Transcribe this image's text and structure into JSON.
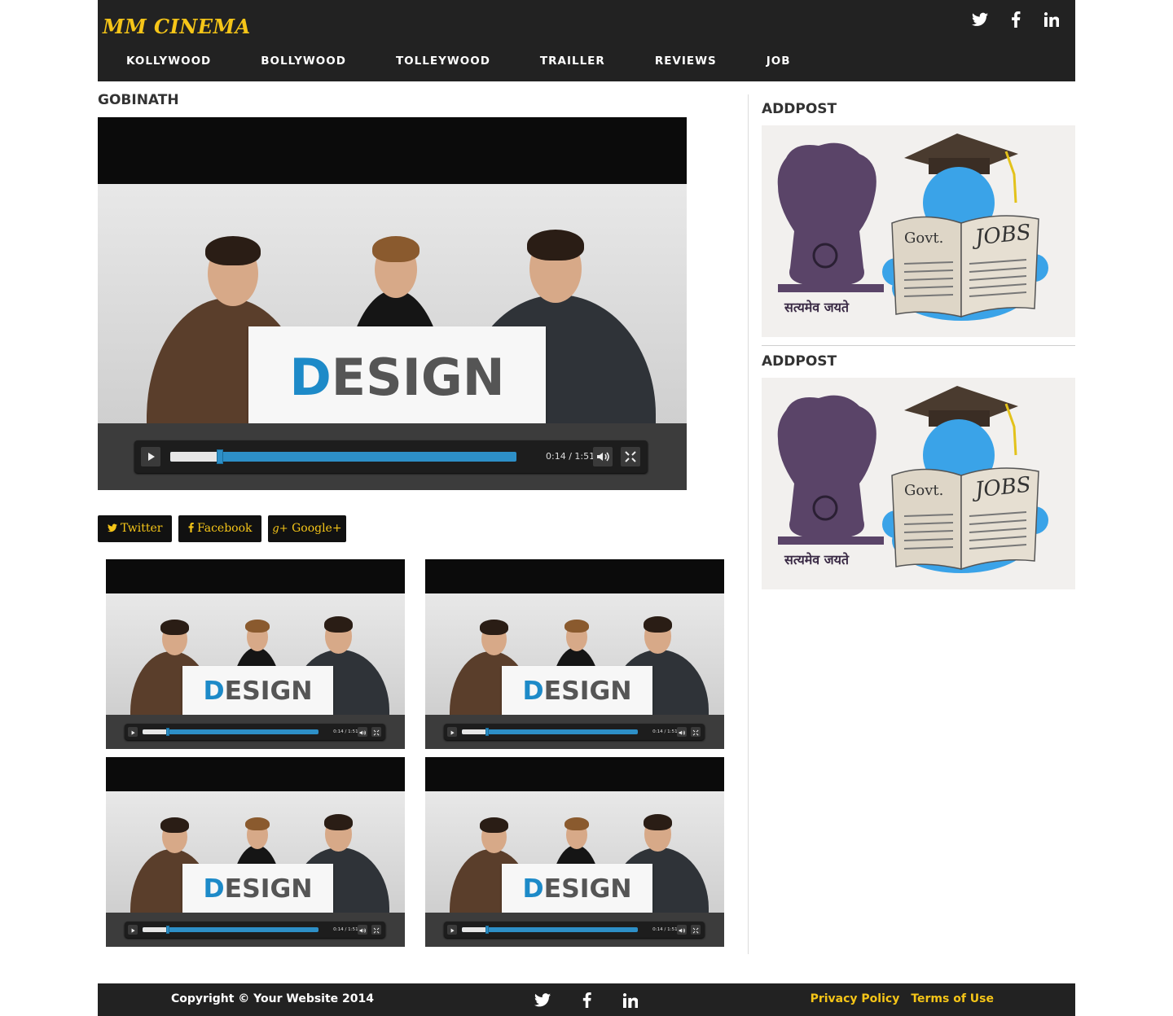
{
  "site": {
    "logo": "MM CINEMA",
    "nav": [
      "KOLLYWOOD",
      "BOLLYWOOD",
      "TOLLEYWOOD",
      "TRAILLER",
      "REVIEWS",
      "JOB"
    ],
    "social_icons": [
      "twitter-icon",
      "facebook-icon",
      "linkedin-icon"
    ]
  },
  "main": {
    "title": "GOBINATH",
    "video": {
      "sign_text_first": "D",
      "sign_text_rest": "ESIGN",
      "time": "0:14 / 1:51",
      "progress": 0.14
    },
    "share": {
      "twitter": "Twitter",
      "facebook": "Facebook",
      "google": "Google+"
    }
  },
  "sidebar": {
    "ads": [
      {
        "title": "ADDPOST",
        "govt": "Govt.",
        "jobs": "JOBS",
        "motto": "सत्यमेव जयते"
      },
      {
        "title": "ADDPOST",
        "govt": "Govt.",
        "jobs": "JOBS",
        "motto": "सत्यमेव जयते"
      }
    ]
  },
  "footer": {
    "copyright": "Copyright © Your Website 2014",
    "privacy": "Privacy Policy",
    "terms": "Terms of Use"
  },
  "colors": {
    "header_bg": "#222222",
    "accent": "#f5c518",
    "player_blue": "#2d8fc7"
  }
}
